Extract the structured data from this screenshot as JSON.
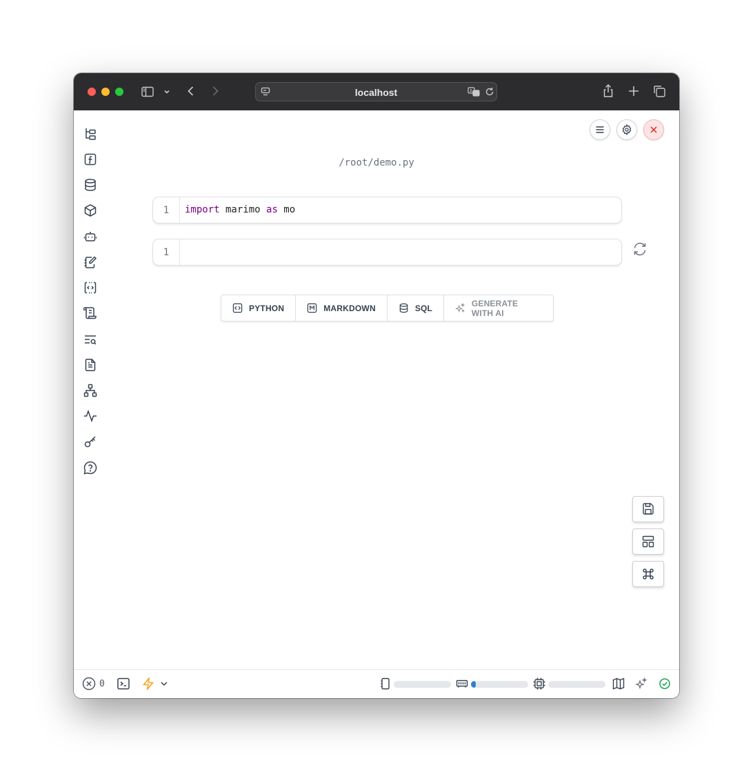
{
  "browser": {
    "url": "localhost"
  },
  "notebook": {
    "filename": "/root/demo.py",
    "cells": [
      {
        "line_number": "1",
        "code_tokens": [
          {
            "text": "import",
            "kind": "keyword"
          },
          {
            "text": " marimo ",
            "kind": "plain"
          },
          {
            "text": "as",
            "kind": "keyword"
          },
          {
            "text": " mo",
            "kind": "plain"
          }
        ]
      },
      {
        "line_number": "1",
        "code_tokens": []
      }
    ]
  },
  "add_cell_bar": {
    "python": "PYTHON",
    "markdown": "MARKDOWN",
    "sql": "SQL",
    "generate_ai": "GENERATE WITH AI"
  },
  "footer": {
    "error_count": "0",
    "meters": [
      {
        "name": "disk",
        "fraction": 0.0
      },
      {
        "name": "memory",
        "fraction": 0.08
      },
      {
        "name": "cpu",
        "fraction": 0.0
      }
    ]
  },
  "colors": {
    "keyword": "#770088",
    "run_button": "#fdf3b0",
    "close_button": "#fde4e4",
    "status_ok": "#16a34a",
    "lightning": "#f5a524",
    "meter_fill": "#2f7fd6"
  },
  "icons": {
    "sidebar": [
      "file-tree-icon",
      "function-icon",
      "database-icon",
      "package-icon",
      "ai-bot-icon",
      "notebook-pen-icon",
      "code-snippet-icon",
      "scroll-icon",
      "search-outline-icon",
      "document-icon",
      "dependency-graph-icon",
      "activity-icon",
      "key-icon",
      "help-icon"
    ]
  }
}
